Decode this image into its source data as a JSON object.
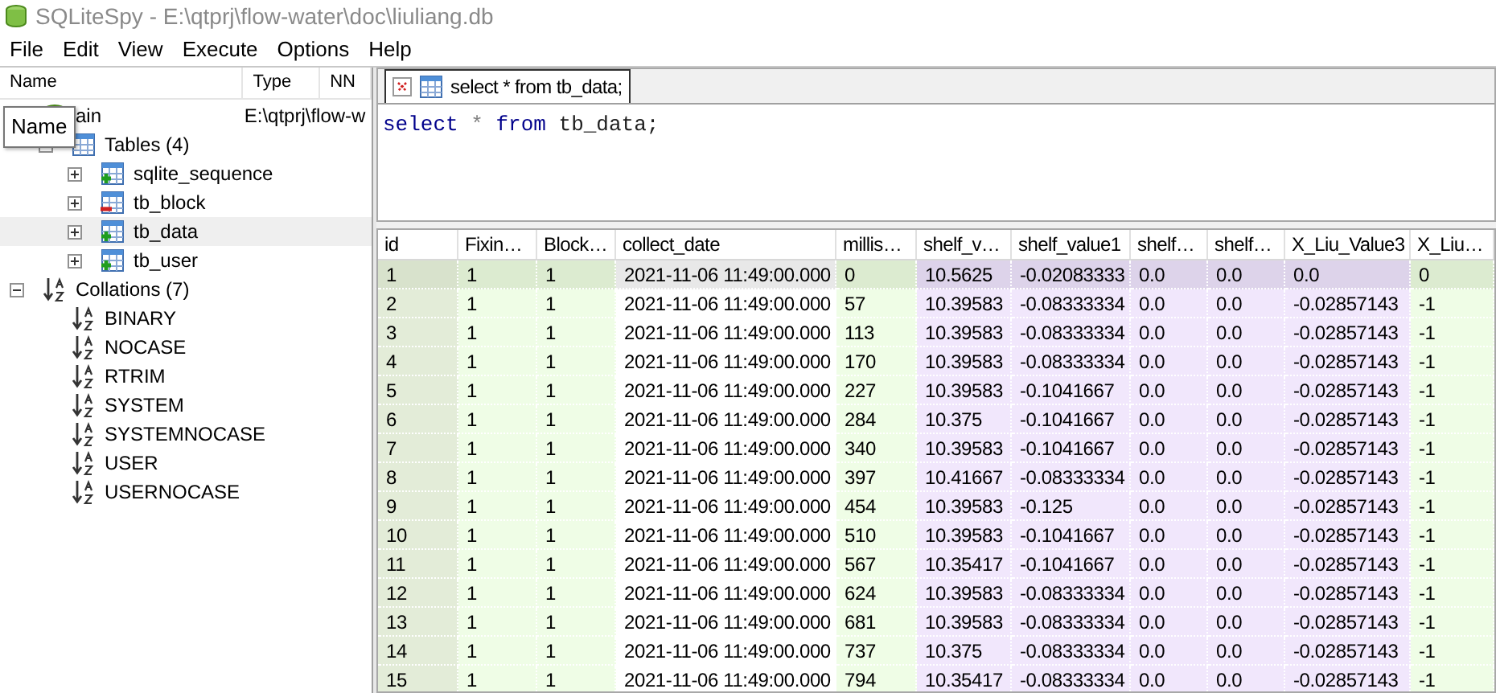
{
  "window": {
    "title": "SQLiteSpy - E:\\qtprj\\flow-water\\doc\\liuliang.db"
  },
  "menu": [
    "File",
    "Edit",
    "View",
    "Execute",
    "Options",
    "Help"
  ],
  "schema": {
    "columns": [
      "Name",
      "Type",
      "NN"
    ],
    "tooltip": "Name",
    "tree": [
      {
        "label": "ain",
        "type": "E:\\qtprj\\flow-w",
        "kind": "database",
        "selected": false,
        "children": [
          {
            "label": "Tables (4)",
            "kind": "tables",
            "expanded": true,
            "selected": false,
            "children": [
              {
                "label": "sqlite_sequence",
                "kind": "table",
                "removed": false,
                "expanded": false,
                "selected": false
              },
              {
                "label": "tb_block",
                "kind": "table",
                "removed": true,
                "expanded": false,
                "selected": false
              },
              {
                "label": "tb_data",
                "kind": "table",
                "removed": false,
                "expanded": false,
                "selected": true
              },
              {
                "label": "tb_user",
                "kind": "table",
                "removed": false,
                "expanded": false,
                "selected": false
              }
            ]
          }
        ]
      },
      {
        "label": "Collations (7)",
        "kind": "collations",
        "expanded": true,
        "selected": false,
        "children": [
          {
            "label": "BINARY",
            "kind": "collation",
            "selected": false
          },
          {
            "label": "NOCASE",
            "kind": "collation",
            "selected": false
          },
          {
            "label": "RTRIM",
            "kind": "collation",
            "selected": false
          },
          {
            "label": "SYSTEM",
            "kind": "collation",
            "selected": false
          },
          {
            "label": "SYSTEMNOCASE",
            "kind": "collation",
            "selected": false
          },
          {
            "label": "USER",
            "kind": "collation",
            "selected": false
          },
          {
            "label": "USERNOCASE",
            "kind": "collation",
            "selected": false
          }
        ]
      }
    ]
  },
  "query_tabs": [
    {
      "label": "select * from tb_data;",
      "selected": true
    }
  ],
  "editor": {
    "tokens": [
      {
        "text": "select",
        "kind": "keyword"
      },
      {
        "text": "*",
        "kind": "operator"
      },
      {
        "text": "from",
        "kind": "keyword"
      },
      {
        "text": "tb_data;",
        "kind": "identifier"
      }
    ]
  },
  "table": {
    "columns": [
      {
        "label": "id",
        "kind": "rowid"
      },
      {
        "label": "Fixin…",
        "kind": "integer"
      },
      {
        "label": "Block…",
        "kind": "integer"
      },
      {
        "label": "collect_date",
        "kind": "text"
      },
      {
        "label": "millis…",
        "kind": "integer"
      },
      {
        "label": "shelf_v…",
        "kind": "real"
      },
      {
        "label": "shelf_value1",
        "kind": "real"
      },
      {
        "label": "shelf…",
        "kind": "real"
      },
      {
        "label": "shelf…",
        "kind": "real"
      },
      {
        "label": "X_Liu_Value3",
        "kind": "real"
      },
      {
        "label": "X_Liu…",
        "kind": "integer"
      }
    ],
    "rows": [
      {
        "selected": true,
        "cells": [
          "1",
          "1",
          "1",
          "2021-11-06 11:49:00.000",
          "0",
          "10.5625",
          "-0.02083333",
          "0.0",
          "0.0",
          "0.0",
          "0"
        ]
      },
      {
        "selected": false,
        "cells": [
          "2",
          "1",
          "1",
          "2021-11-06 11:49:00.000",
          "57",
          "10.39583",
          "-0.08333334",
          "0.0",
          "0.0",
          "-0.02857143",
          "-1"
        ]
      },
      {
        "selected": false,
        "cells": [
          "3",
          "1",
          "1",
          "2021-11-06 11:49:00.000",
          "113",
          "10.39583",
          "-0.08333334",
          "0.0",
          "0.0",
          "-0.02857143",
          "-1"
        ]
      },
      {
        "selected": false,
        "cells": [
          "4",
          "1",
          "1",
          "2021-11-06 11:49:00.000",
          "170",
          "10.39583",
          "-0.08333334",
          "0.0",
          "0.0",
          "-0.02857143",
          "-1"
        ]
      },
      {
        "selected": false,
        "cells": [
          "5",
          "1",
          "1",
          "2021-11-06 11:49:00.000",
          "227",
          "10.39583",
          "-0.1041667",
          "0.0",
          "0.0",
          "-0.02857143",
          "-1"
        ]
      },
      {
        "selected": false,
        "cells": [
          "6",
          "1",
          "1",
          "2021-11-06 11:49:00.000",
          "284",
          "10.375",
          "-0.1041667",
          "0.0",
          "0.0",
          "-0.02857143",
          "-1"
        ]
      },
      {
        "selected": false,
        "cells": [
          "7",
          "1",
          "1",
          "2021-11-06 11:49:00.000",
          "340",
          "10.39583",
          "-0.1041667",
          "0.0",
          "0.0",
          "-0.02857143",
          "-1"
        ]
      },
      {
        "selected": false,
        "cells": [
          "8",
          "1",
          "1",
          "2021-11-06 11:49:00.000",
          "397",
          "10.41667",
          "-0.08333334",
          "0.0",
          "0.0",
          "-0.02857143",
          "-1"
        ]
      },
      {
        "selected": false,
        "cells": [
          "9",
          "1",
          "1",
          "2021-11-06 11:49:00.000",
          "454",
          "10.39583",
          "-0.125",
          "0.0",
          "0.0",
          "-0.02857143",
          "-1"
        ]
      },
      {
        "selected": false,
        "cells": [
          "10",
          "1",
          "1",
          "2021-11-06 11:49:00.000",
          "510",
          "10.39583",
          "-0.1041667",
          "0.0",
          "0.0",
          "-0.02857143",
          "-1"
        ]
      },
      {
        "selected": false,
        "cells": [
          "11",
          "1",
          "1",
          "2021-11-06 11:49:00.000",
          "567",
          "10.35417",
          "-0.1041667",
          "0.0",
          "0.0",
          "-0.02857143",
          "-1"
        ]
      },
      {
        "selected": false,
        "cells": [
          "12",
          "1",
          "1",
          "2021-11-06 11:49:00.000",
          "624",
          "10.39583",
          "-0.08333334",
          "0.0",
          "0.0",
          "-0.02857143",
          "-1"
        ]
      },
      {
        "selected": false,
        "cells": [
          "13",
          "1",
          "1",
          "2021-11-06 11:49:00.000",
          "681",
          "10.39583",
          "-0.08333334",
          "0.0",
          "0.0",
          "-0.02857143",
          "-1"
        ]
      },
      {
        "selected": false,
        "cells": [
          "14",
          "1",
          "1",
          "2021-11-06 11:49:00.000",
          "737",
          "10.375",
          "-0.08333334",
          "0.0",
          "0.0",
          "-0.02857143",
          "-1"
        ]
      },
      {
        "selected": false,
        "cells": [
          "15",
          "1",
          "1",
          "2021-11-06 11:49:00.000",
          "794",
          "10.35417",
          "-0.08333334",
          "0.0",
          "0.0",
          "-0.02857143",
          "-1"
        ]
      }
    ]
  }
}
